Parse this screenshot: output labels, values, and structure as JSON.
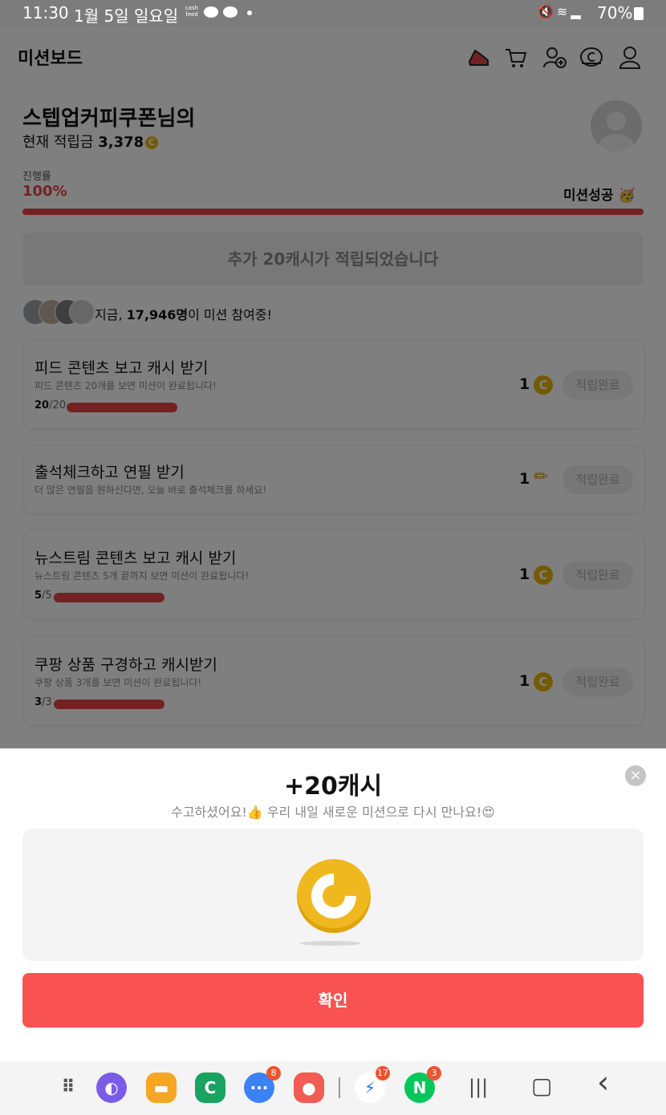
{
  "status_bar": {
    "time": "11:30",
    "date": "1월 5일 일요일",
    "cashfeed_top": "cash",
    "cashfeed_bottom": "feed",
    "battery": "70%"
  },
  "app": {
    "title": "미션보드",
    "header_icons": [
      "shoe-icon",
      "cart-icon",
      "add-user-icon",
      "coin-icon",
      "user-icon"
    ]
  },
  "profile": {
    "nickname": "스텝업커피쿠폰님의",
    "points_label": "현재 적립금",
    "points_value": "3,378",
    "coin_symbol": "C"
  },
  "progress": {
    "label": "진행률",
    "percent": "100%",
    "fraction": 1.0,
    "status_text": "미션성공",
    "status_emoji": "🥳"
  },
  "notice": "추가 20캐시가 적립되었습니다",
  "participants": {
    "prefix": "지금, ",
    "count": "17,946명",
    "suffix": "이 미션 참여중!"
  },
  "missions": [
    {
      "title": "피드 콘텐츠 보고 캐시 받기",
      "desc": "피드 콘텐츠 20개를 보면 미션이 완료됩니다!",
      "count_done": "20",
      "count_total": "/20",
      "reward": "1",
      "reward_icon": "coin-icon",
      "button": "적립완료"
    },
    {
      "title": "출석체크하고 연필 받기",
      "desc": "더 많은 연필을 원하신다면, 오늘 바로 출석체크를 하세요!",
      "count_done": "",
      "count_total": "",
      "reward": "1",
      "reward_icon": "pencil-icon",
      "button": "적립완료"
    },
    {
      "title": "뉴스트림 콘텐츠 보고 캐시 받기",
      "desc": "뉴스트림 콘텐츠 5개 끝까지 보면 미션이 완료됩니다!",
      "count_done": "5",
      "count_total": "/5",
      "reward": "1",
      "reward_icon": "coin-icon",
      "button": "적립완료"
    },
    {
      "title": "쿠팡 상품 구경하고 캐시받기",
      "desc": "쿠팡 상품 3개를 보면 미션이 완료됩니다!",
      "count_done": "3",
      "count_total": "/3",
      "reward": "1",
      "reward_icon": "coin-icon",
      "button": "적립완료"
    }
  ],
  "sheet": {
    "title": "+20캐시",
    "subtitle": "수고하셨어요!👍 우리 내일 새로운 미션으로 다시 만나요!😍",
    "close": "×",
    "confirm": "확인"
  },
  "nav_bar": {
    "apps": [
      {
        "name": "app-drawer-icon",
        "label": "⠿",
        "color": "#f4f4f4"
      },
      {
        "name": "samsung-internet-icon",
        "label": "◐",
        "color": "#7a5ce6"
      },
      {
        "name": "my-files-icon",
        "label": "▬",
        "color": "#f5a623"
      },
      {
        "name": "c-app-icon",
        "label": "C",
        "color": "#1aa260"
      },
      {
        "name": "messages-icon",
        "label": "···",
        "color": "#3b82f6",
        "badge": "8"
      },
      {
        "name": "contacts-icon",
        "label": "●",
        "color": "#f25c54"
      },
      {
        "name": "messenger-icon",
        "label": "⚡",
        "color": "#ffffff",
        "badge": "17"
      },
      {
        "name": "naver-icon",
        "label": "N",
        "color": "#03c75a",
        "badge": "3"
      }
    ],
    "recents": "|||",
    "home": "▢",
    "back": "‹"
  }
}
